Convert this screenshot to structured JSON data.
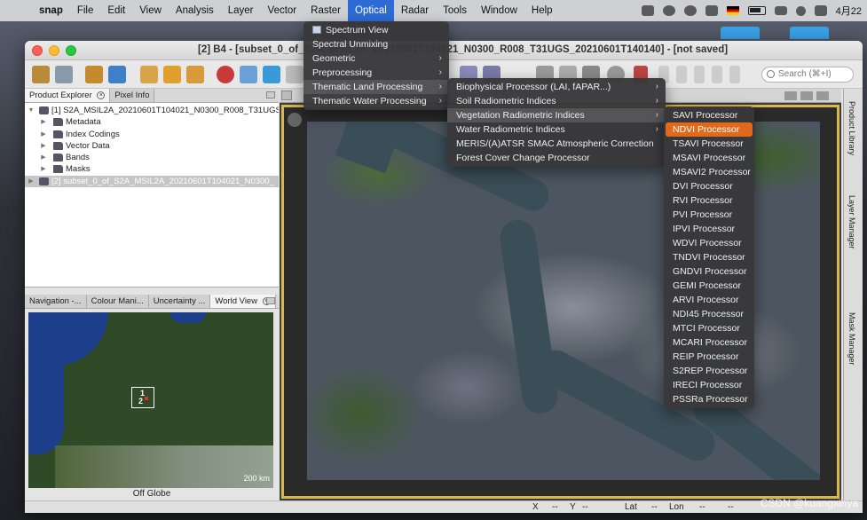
{
  "menubar": {
    "app_name": "snap",
    "items": [
      "File",
      "Edit",
      "View",
      "Analysis",
      "Layer",
      "Vector",
      "Raster",
      "Optical",
      "Radar",
      "Tools",
      "Window",
      "Help"
    ],
    "active_item": "Optical",
    "clock": "4月22"
  },
  "window": {
    "title": "[2] B4 - [subset_0_of_S2A_MSIL2A_20210601T104021_N0300_R008_T31UGS_20210601T140140] - [not saved]",
    "search_placeholder": "Search (⌘+I)"
  },
  "left_panel": {
    "tabs": [
      "Product Explorer",
      "Pixel Info"
    ],
    "tree": [
      {
        "label": "[1] S2A_MSIL2A_20210601T104021_N0300_R008_T31UGS",
        "level": 0,
        "type": "product",
        "expanded": true
      },
      {
        "label": "Metadata",
        "level": 1,
        "type": "folder"
      },
      {
        "label": "Index Codings",
        "level": 1,
        "type": "folder"
      },
      {
        "label": "Vector Data",
        "level": 1,
        "type": "folder"
      },
      {
        "label": "Bands",
        "level": 1,
        "type": "folder"
      },
      {
        "label": "Masks",
        "level": 1,
        "type": "folder"
      },
      {
        "label": "[2] subset_0_of_S2A_MSIL2A_20210601T104021_N0300_",
        "level": 0,
        "type": "product",
        "expanded": false,
        "selected": true
      }
    ]
  },
  "world_view": {
    "tabs": [
      "Navigation -...",
      "Colour Mani...",
      "Uncertainty ...",
      "World View"
    ],
    "scale": "200 km",
    "footprint_labels": [
      "1",
      "2"
    ],
    "footer": "Off Globe"
  },
  "right_dock": {
    "labels": [
      "Product Library",
      "Layer Manager",
      "Mask Manager"
    ]
  },
  "status": {
    "x_label": "X",
    "x_value": "--",
    "y_label": "Y",
    "y_value": "--",
    "lat_label": "Lat",
    "lat_value": "--",
    "lon_label": "Lon",
    "lon_value": "--",
    "extra_value": "--"
  },
  "menus": {
    "optical": [
      {
        "label": "Spectrum View",
        "icon": true,
        "submenu": false
      },
      {
        "label": "Spectral Unmixing",
        "submenu": false
      },
      {
        "label": "Geometric",
        "submenu": true
      },
      {
        "label": "Preprocessing",
        "submenu": true
      },
      {
        "label": "Thematic Land Processing",
        "submenu": true,
        "selected": true
      },
      {
        "label": "Thematic Water Processing",
        "submenu": true
      }
    ],
    "thematic_land": [
      {
        "label": "Biophysical Processor (LAI, fAPAR...)",
        "submenu": true
      },
      {
        "label": "Soil Radiometric Indices",
        "submenu": true
      },
      {
        "label": "Vegetation Radiometric Indices",
        "submenu": true,
        "selected": true
      },
      {
        "label": "Water Radiometric Indices",
        "submenu": true
      },
      {
        "label": "MERIS/(A)ATSR SMAC Atmospheric Correction",
        "submenu": false
      },
      {
        "label": "Forest Cover Change Processor",
        "submenu": false
      }
    ],
    "vegetation": [
      {
        "label": "SAVI Processor"
      },
      {
        "label": "NDVI Processor",
        "highlighted": true
      },
      {
        "label": "TSAVI Processor"
      },
      {
        "label": "MSAVI Processor"
      },
      {
        "label": "MSAVI2 Processor"
      },
      {
        "label": "DVI Processor"
      },
      {
        "label": "RVI Processor"
      },
      {
        "label": "PVI Processor"
      },
      {
        "label": "IPVI Processor"
      },
      {
        "label": "WDVI Processor"
      },
      {
        "label": "TNDVI Processor"
      },
      {
        "label": "GNDVI Processor"
      },
      {
        "label": "GEMI Processor"
      },
      {
        "label": "ARVI Processor"
      },
      {
        "label": "NDI45 Processor"
      },
      {
        "label": "MTCI Processor"
      },
      {
        "label": "MCARI Processor"
      },
      {
        "label": "REIP Processor"
      },
      {
        "label": "S2REP Processor"
      },
      {
        "label": "IRECI Processor"
      },
      {
        "label": "PSSRa Processor"
      }
    ]
  },
  "watermark": "CSDN @kuangxinya"
}
